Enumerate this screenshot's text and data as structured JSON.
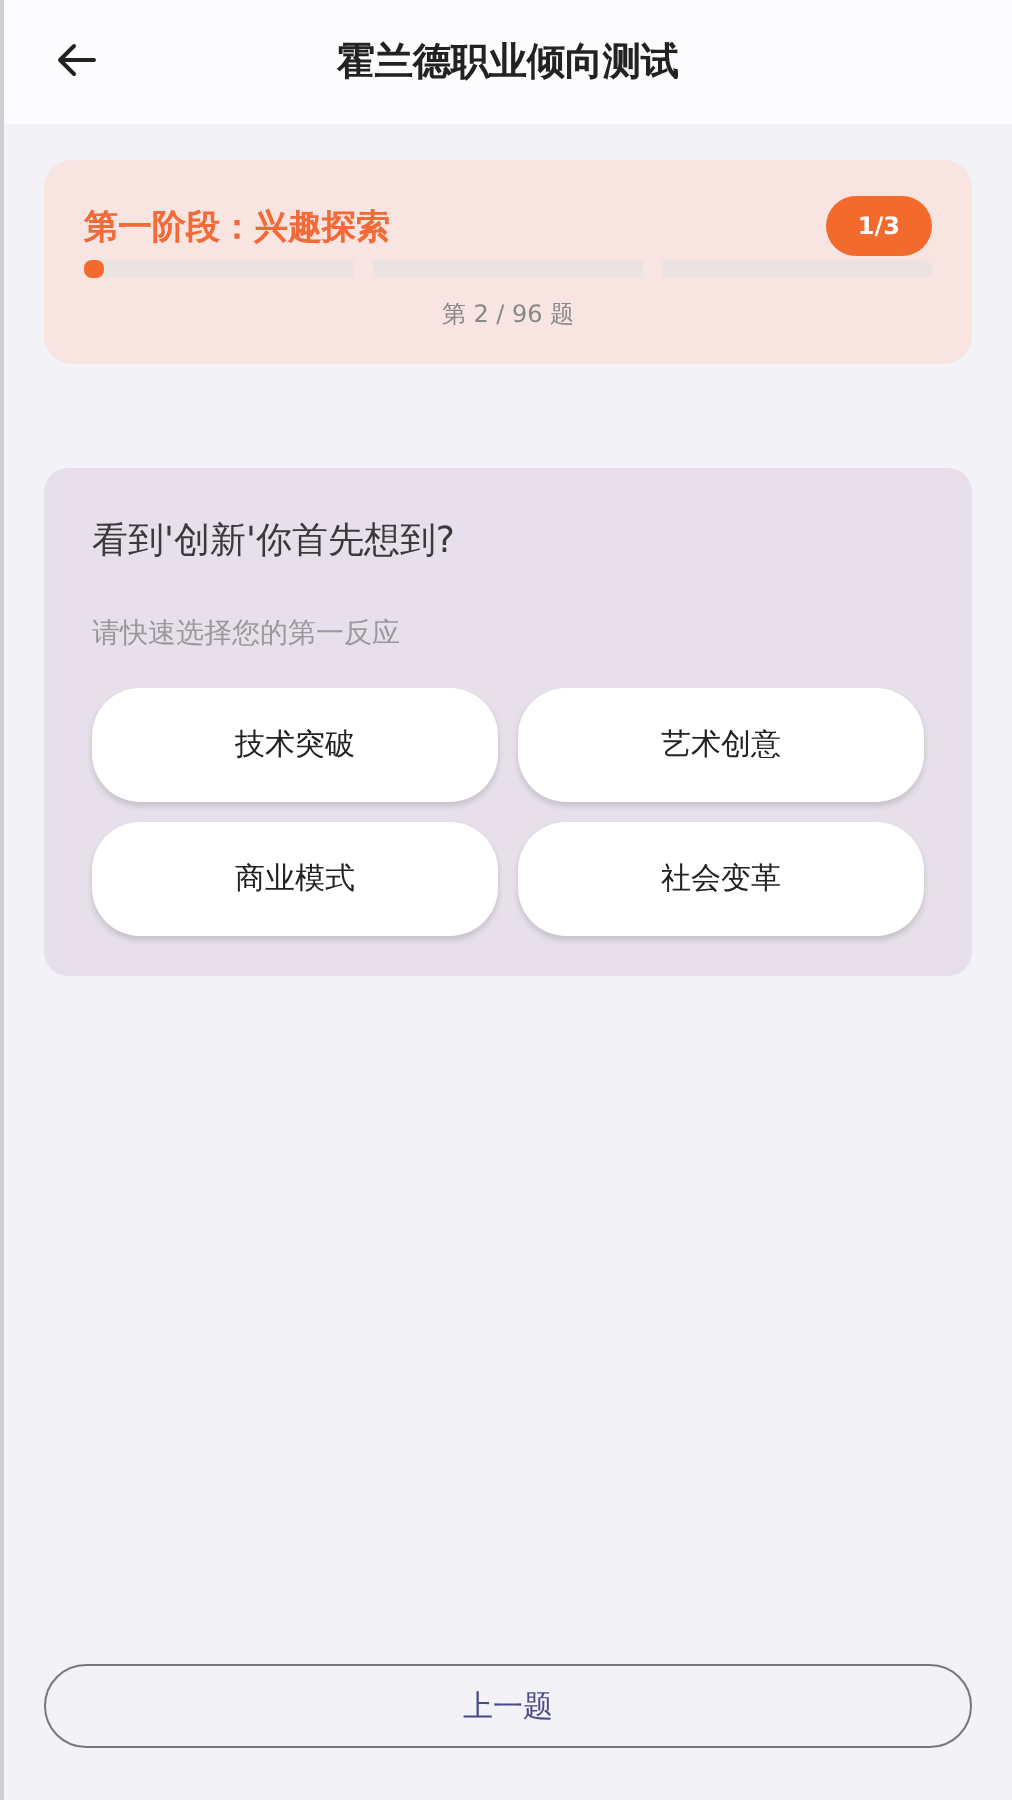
{
  "header": {
    "title": "霍兰德职业倾向测试"
  },
  "stage": {
    "title": "第一阶段：兴趣探索",
    "badge": "1/3",
    "progress": {
      "level": 0.024
    },
    "counter": "第 2 / 96 题"
  },
  "question": {
    "text": "看到'创新'你首先想到?",
    "hint": "请快速选择您的第一反应",
    "options": [
      {
        "label": "技术突破",
        "selected": false
      },
      {
        "label": "艺术创意",
        "selected": false
      },
      {
        "label": "商业模式",
        "selected": false
      },
      {
        "label": "社会变革",
        "selected": false
      }
    ]
  },
  "footer": {
    "prev_button": "上一题"
  }
}
